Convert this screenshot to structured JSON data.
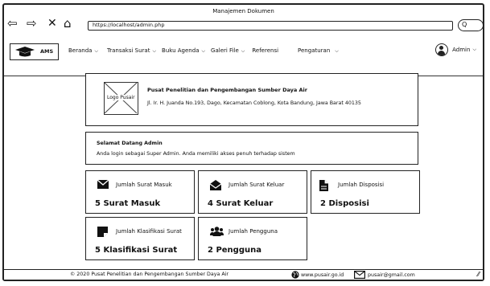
{
  "window": {
    "title": "Manajemen Dokumen",
    "url": "https://localhost/admin.php",
    "search_label": "Q"
  },
  "navbar": {
    "brand": "AMS",
    "menu": [
      {
        "label": "Beranda",
        "dropdown": true
      },
      {
        "label": "Transaksi Surat",
        "dropdown": true
      },
      {
        "label": "Buku Agenda",
        "dropdown": true
      },
      {
        "label": "Galeri File",
        "dropdown": true
      },
      {
        "label": "Referensi",
        "dropdown": false
      },
      {
        "label": "Pengaturan",
        "dropdown": true
      }
    ],
    "user": "Admin"
  },
  "org": {
    "logo_alt": "Logo Pusair",
    "name": "Pusat Penelitian dan Pengembangan Sumber Daya Air",
    "address": "Jl. Ir. H. Juanda No.193, Dago, Kecamatan Coblong, Kota Bandung, Jawa Barat 40135"
  },
  "welcome": {
    "title": "Selamat Datang Admin",
    "text": "Anda login sebagai Super Admin. Anda memiliki akses penuh terhadap sistem"
  },
  "stats": [
    {
      "icon": "envelope-icon",
      "label": "Jumlah Surat Masuk",
      "value": "5 Surat Masuk"
    },
    {
      "icon": "open-envelope-icon",
      "label": "Jumlah Surat Keluar",
      "value": "4 Surat Keluar"
    },
    {
      "icon": "document-icon",
      "label": "Jumlah Disposisi",
      "value": "2 Disposisi"
    },
    {
      "icon": "tag-icon",
      "label": "Jumlah Klasifikasi Surat",
      "value": "5 Klasifikasi Surat"
    },
    {
      "icon": "users-icon",
      "label": "Jumlah Pengguna",
      "value": "2 Pengguna"
    }
  ],
  "footer": {
    "copyright": "© 2020 Pusat Penelitian dan Pengembangan Sumber Daya Air",
    "website": "www.pusair.go.id",
    "email": "pusair@gmail.com"
  }
}
